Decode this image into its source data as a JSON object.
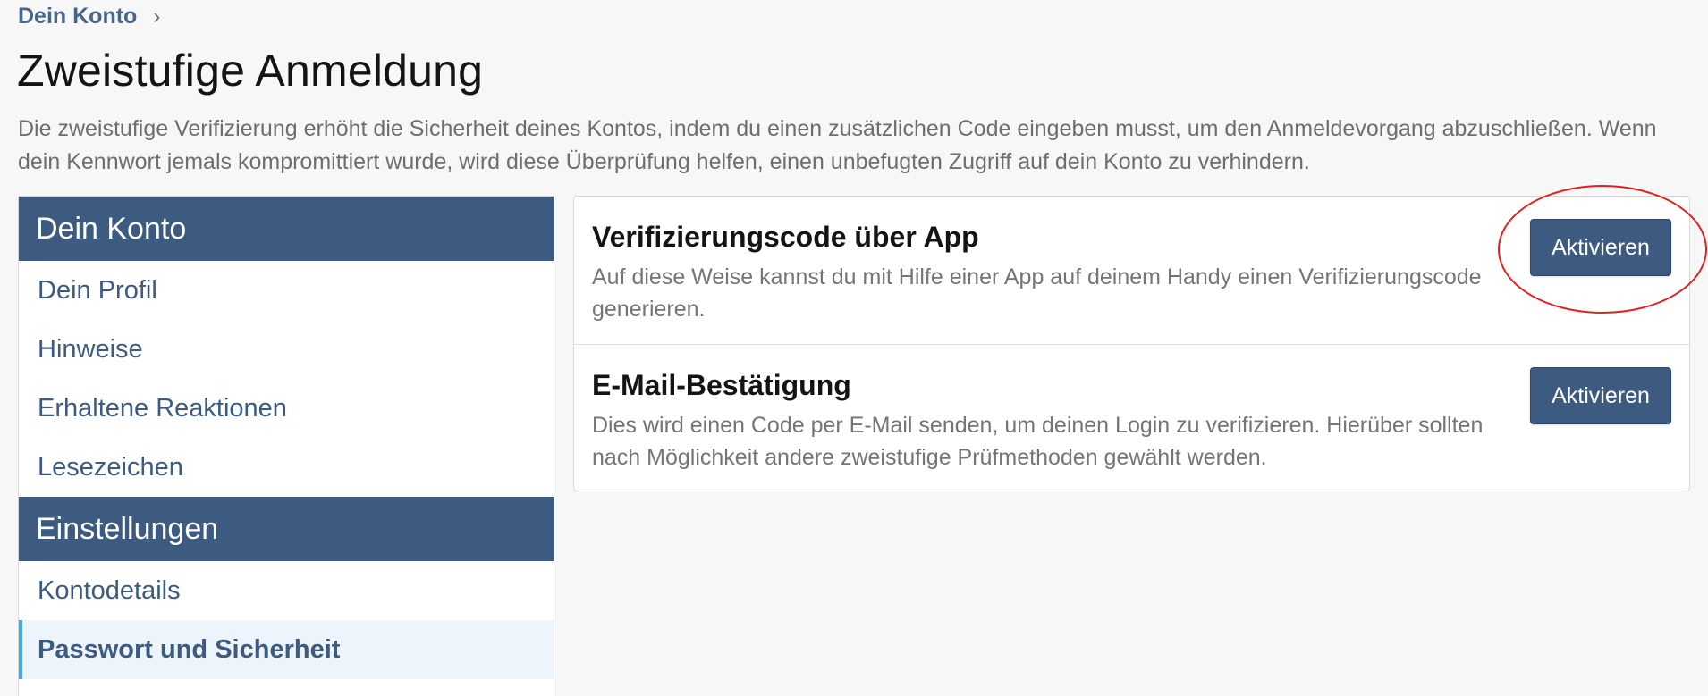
{
  "breadcrumb": {
    "label": "Dein Konto",
    "chevron": "›"
  },
  "page": {
    "title": "Zweistufige Anmeldung",
    "description": "Die zweistufige Verifizierung erhöht die Sicherheit deines Kontos, indem du einen zusätzlichen Code eingeben musst, um den Anmeldevorgang abzuschließen. Wenn dein Kennwort jemals kompromittiert wurde, wird diese Überprüfung helfen, einen unbefugten Zugriff auf dein Konto zu verhindern."
  },
  "sidebar": {
    "sections": [
      {
        "header": "Dein Konto",
        "items": [
          {
            "label": "Dein Profil"
          },
          {
            "label": "Hinweise"
          },
          {
            "label": "Erhaltene Reaktionen"
          },
          {
            "label": "Lesezeichen"
          }
        ]
      },
      {
        "header": "Einstellungen",
        "items": [
          {
            "label": "Kontodetails"
          },
          {
            "label": "Passwort und Sicherheit",
            "active": true
          }
        ]
      }
    ]
  },
  "options": [
    {
      "title": "Verifizierungscode über App",
      "description": "Auf diese Weise kannst du mit Hilfe einer App auf deinem Handy einen Verifizierungscode generieren.",
      "button_label": "Aktivieren"
    },
    {
      "title": "E-Mail-Bestätigung",
      "description": "Dies wird einen Code per E-Mail senden, um deinen Login zu verifizieren. Hierüber sollten nach Möglichkeit andere zweistufige Prüfmethoden gewählt werden.",
      "button_label": "Aktivieren"
    }
  ],
  "colors": {
    "primary": "#3d5a80",
    "active_indicator": "#47a7eb",
    "annotation": "#e02020"
  }
}
